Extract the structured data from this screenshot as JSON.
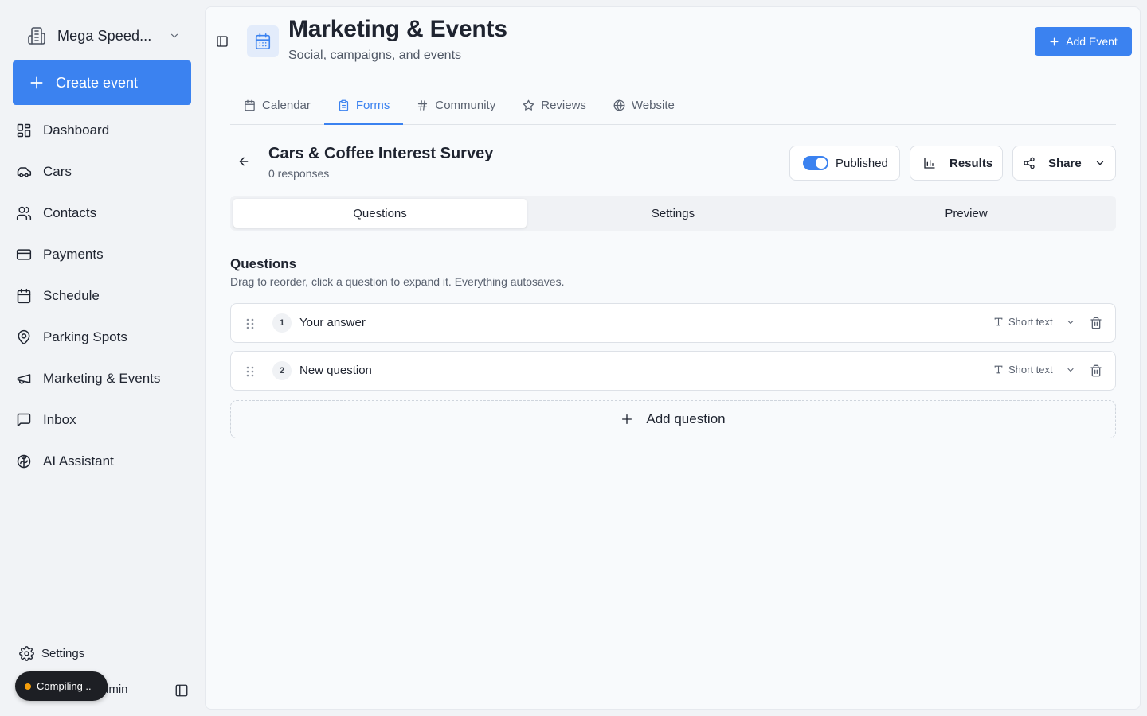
{
  "sidebar": {
    "org_name": "Mega Speed...",
    "create_label": "Create event",
    "items": [
      {
        "label": "Dashboard",
        "icon": "dashboard-icon"
      },
      {
        "label": "Cars",
        "icon": "car-icon"
      },
      {
        "label": "Contacts",
        "icon": "users-icon"
      },
      {
        "label": "Payments",
        "icon": "credit-card-icon"
      },
      {
        "label": "Schedule",
        "icon": "calendar-icon"
      },
      {
        "label": "Parking Spots",
        "icon": "map-pin-icon"
      },
      {
        "label": "Marketing & Events",
        "icon": "megaphone-icon"
      },
      {
        "label": "Inbox",
        "icon": "message-square-icon"
      },
      {
        "label": "AI Assistant",
        "icon": "brain-icon"
      }
    ],
    "settings_label": "Settings",
    "user_label": "dmin"
  },
  "toast": {
    "label": "Compiling .."
  },
  "header": {
    "title": "Marketing & Events",
    "subtitle": "Social, campaigns, and events",
    "add_event_label": "Add Event"
  },
  "tabs": [
    {
      "label": "Calendar",
      "icon": "calendar-icon",
      "active": false
    },
    {
      "label": "Forms",
      "icon": "clipboard-icon",
      "active": true
    },
    {
      "label": "Community",
      "icon": "hash-icon",
      "active": false
    },
    {
      "label": "Reviews",
      "icon": "star-icon",
      "active": false
    },
    {
      "label": "Website",
      "icon": "globe-icon",
      "active": false
    }
  ],
  "form": {
    "title": "Cars & Coffee Interest Survey",
    "responses": "0 responses",
    "published_label": "Published",
    "published": true,
    "results_label": "Results",
    "share_label": "Share"
  },
  "subtabs": [
    {
      "label": "Questions",
      "active": true
    },
    {
      "label": "Settings",
      "active": false
    },
    {
      "label": "Preview",
      "active": false
    }
  ],
  "questions_section": {
    "heading": "Questions",
    "description": "Drag to reorder, click a question to expand it. Everything autosaves.",
    "add_label": "Add question"
  },
  "questions": [
    {
      "number": "1",
      "text": "Your answer",
      "type": "Short text"
    },
    {
      "number": "2",
      "text": "New question",
      "type": "Short text"
    }
  ],
  "colors": {
    "accent": "#3b82f0",
    "background": "#f1f3f6",
    "surface": "#f8fafc"
  }
}
